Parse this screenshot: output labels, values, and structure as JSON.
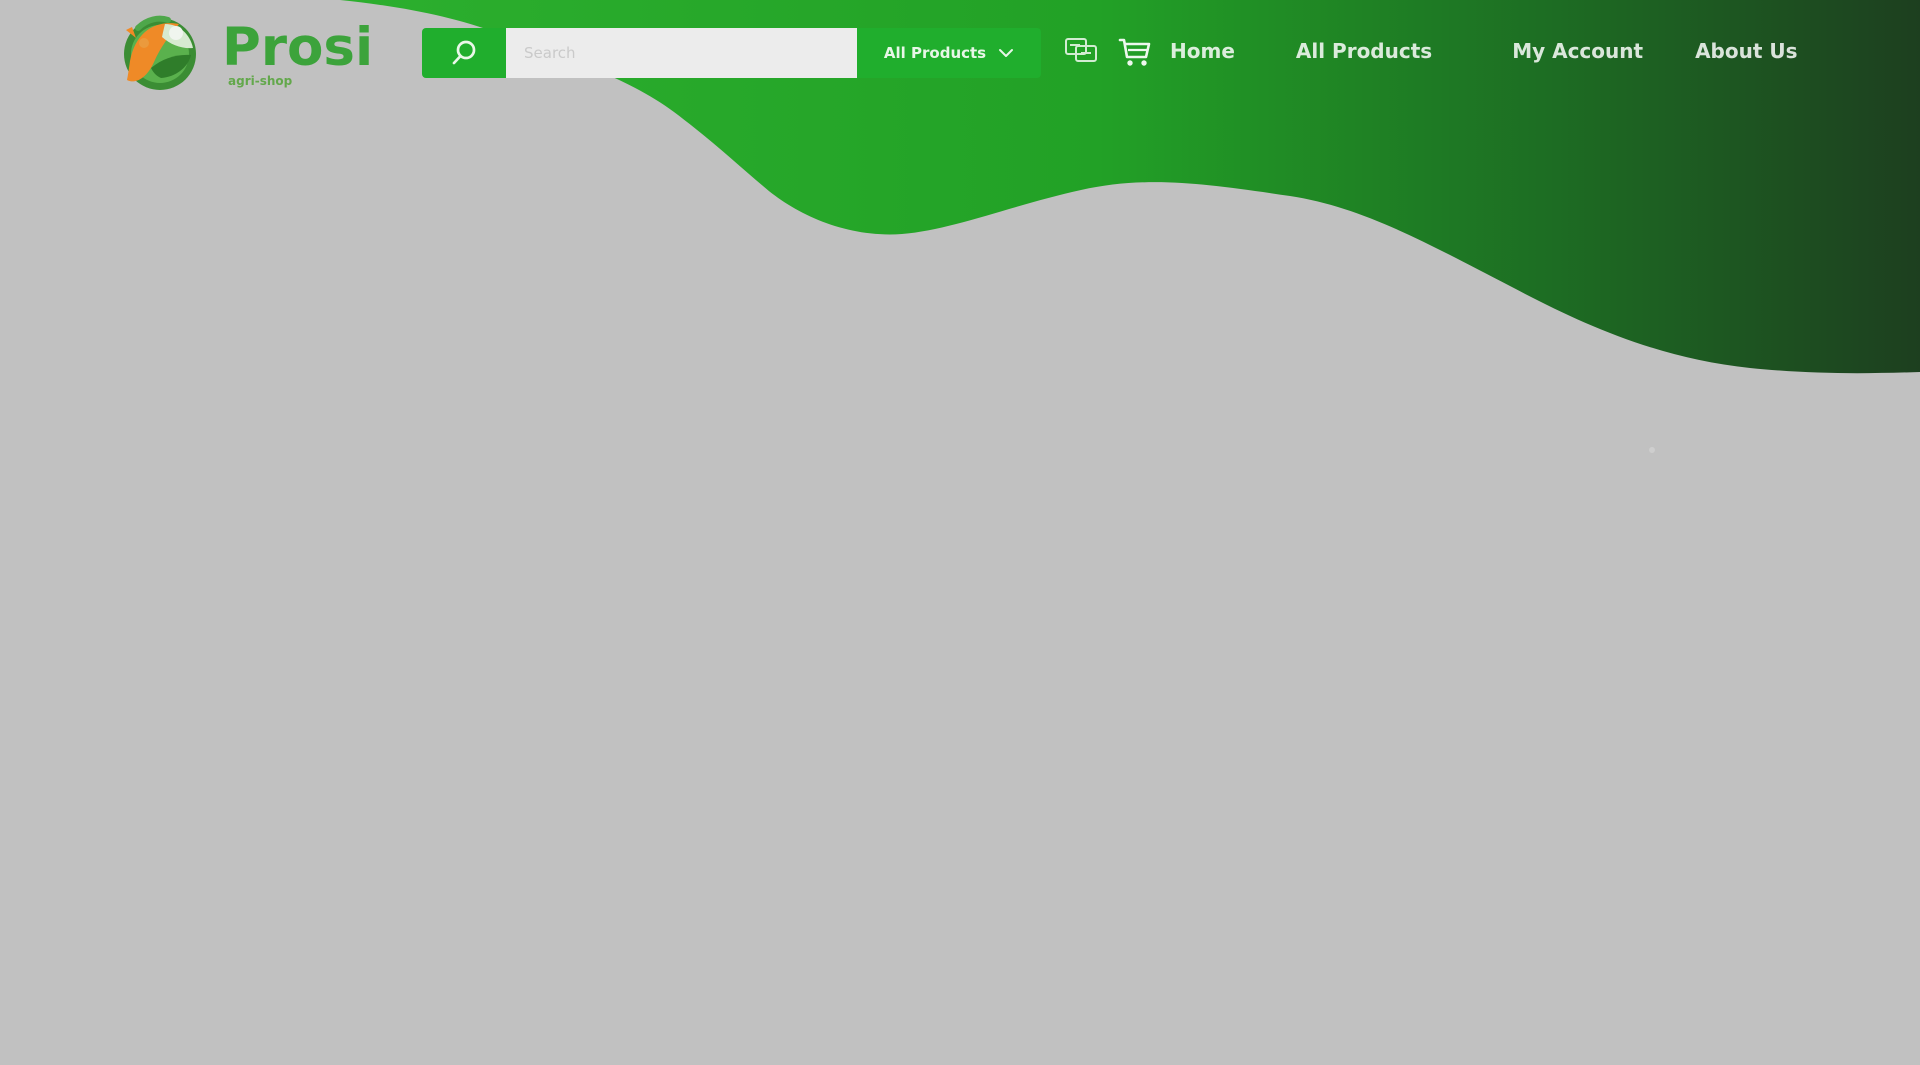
{
  "brand": {
    "name": "Prosi",
    "subtitle": "agri-shop"
  },
  "header": {
    "search": {
      "placeholder": "Search",
      "value": ""
    },
    "category": {
      "selected": "All Products"
    },
    "icons": {
      "search": "search-icon",
      "compare": "compare-icon",
      "cart": "cart-icon",
      "dropdown": "chevron-down-icon"
    },
    "nav": [
      {
        "label": "Home"
      },
      {
        "label": "All Products"
      },
      {
        "label": "My Account"
      },
      {
        "label": "About Us"
      }
    ]
  },
  "colors": {
    "background": "#c1c1c1",
    "brand_green": "#22ad2d",
    "dark_green": "#1f3e20",
    "white": "#ffffff"
  }
}
